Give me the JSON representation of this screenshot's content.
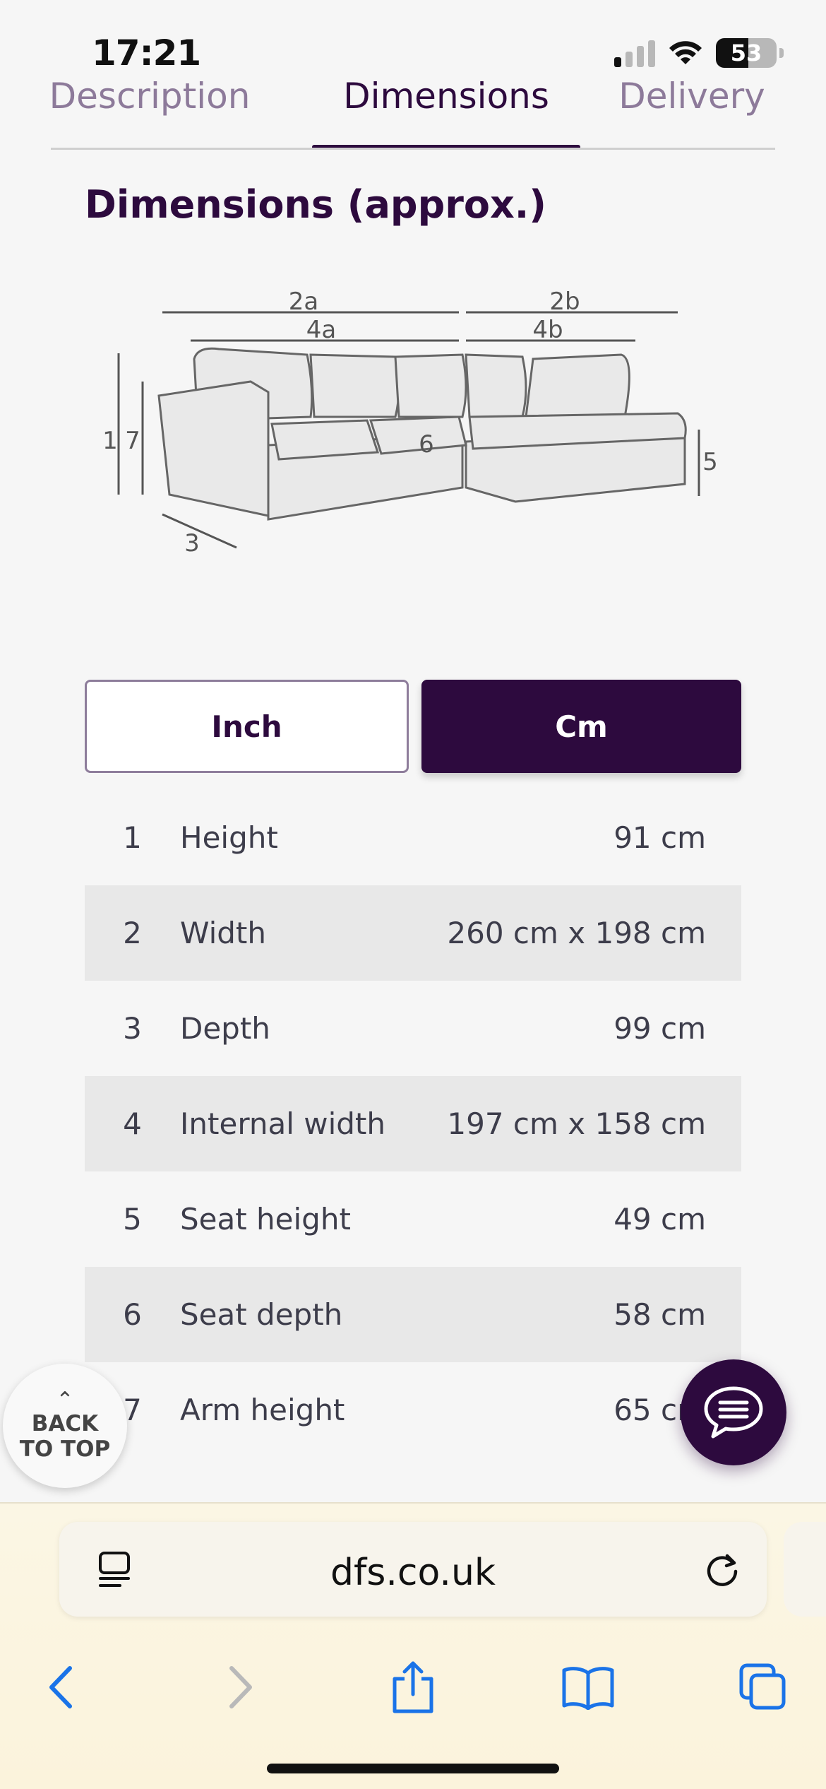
{
  "status": {
    "time": "17:21",
    "battery": "53"
  },
  "tabs": [
    {
      "label": "Description"
    },
    {
      "label": "Dimensions",
      "active": true
    },
    {
      "label": "Delivery"
    }
  ],
  "heading": "Dimensions (approx.)",
  "diagram": {
    "labels": [
      "2a",
      "4a",
      "2b",
      "4b",
      "1",
      "7",
      "6",
      "5",
      "3"
    ]
  },
  "units": {
    "inch": "Inch",
    "cm": "Cm",
    "selected": "Cm"
  },
  "dimensions": [
    {
      "num": "1",
      "label": "Height",
      "value": "91 cm"
    },
    {
      "num": "2",
      "label": "Width",
      "value": "260 cm x 198 cm"
    },
    {
      "num": "3",
      "label": "Depth",
      "value": "99 cm"
    },
    {
      "num": "4",
      "label": "Internal width",
      "value": "197 cm x 158 cm"
    },
    {
      "num": "5",
      "label": "Seat height",
      "value": "49 cm"
    },
    {
      "num": "6",
      "label": "Seat depth",
      "value": "58 cm"
    },
    {
      "num": "7",
      "label": "Arm height",
      "value": "65 cm"
    }
  ],
  "back_to_top": {
    "line1": "BACK",
    "line2": "TO TOP"
  },
  "browser": {
    "url": "dfs.co.uk"
  },
  "colors": {
    "brand": "#2d0a3e",
    "accent_icon": "#1a73e8"
  }
}
